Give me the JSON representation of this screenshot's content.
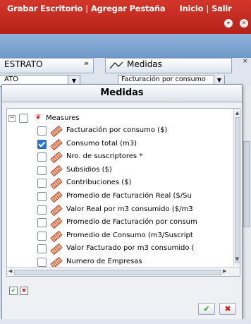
{
  "topbar": {
    "links": [
      "Grabar Escritorio",
      "Agregar Pestaña",
      "Inicio",
      "Salir"
    ],
    "separator": "|",
    "icons": [
      "chevron-down-icon",
      "close-icon"
    ]
  },
  "estrato_panel": {
    "title": "ESTRATO",
    "collapse_icon": "»",
    "selected_value": "ATO"
  },
  "medidas_panel": {
    "title": "Medidas",
    "selected_value": "Facturación por consumo"
  },
  "dialog": {
    "title": "Medidas",
    "root_label": "Measures",
    "items": [
      {
        "label": "Facturación por consumo ($)",
        "checked": false
      },
      {
        "label": "Consumo total (m3)",
        "checked": true
      },
      {
        "label": "Nro. de suscriptores *",
        "checked": false
      },
      {
        "label": "Subsidios ($)",
        "checked": false
      },
      {
        "label": "Contribuciones ($)",
        "checked": false
      },
      {
        "label": "Promedio de Facturación Real ($/Su",
        "checked": false
      },
      {
        "label": "Valor Real por m3 consumido ($/m3",
        "checked": false
      },
      {
        "label": "Promedio de Facturación por consum",
        "checked": false
      },
      {
        "label": "Promedio de Consumo (m3/Suscript",
        "checked": false
      },
      {
        "label": "Valor Facturado por m3 consumido (",
        "checked": false
      },
      {
        "label": "Numero de Empresas",
        "checked": false
      }
    ],
    "ok_symbol": "✔",
    "cancel_symbol": "✖"
  },
  "colors": {
    "topbar_red": "#c42a20",
    "toolbar_blue": "#7ea6d3",
    "checkbox_checked": "#2a7bd6",
    "ok_green": "#2e9a2e",
    "cancel_red": "#cc1e1e"
  }
}
